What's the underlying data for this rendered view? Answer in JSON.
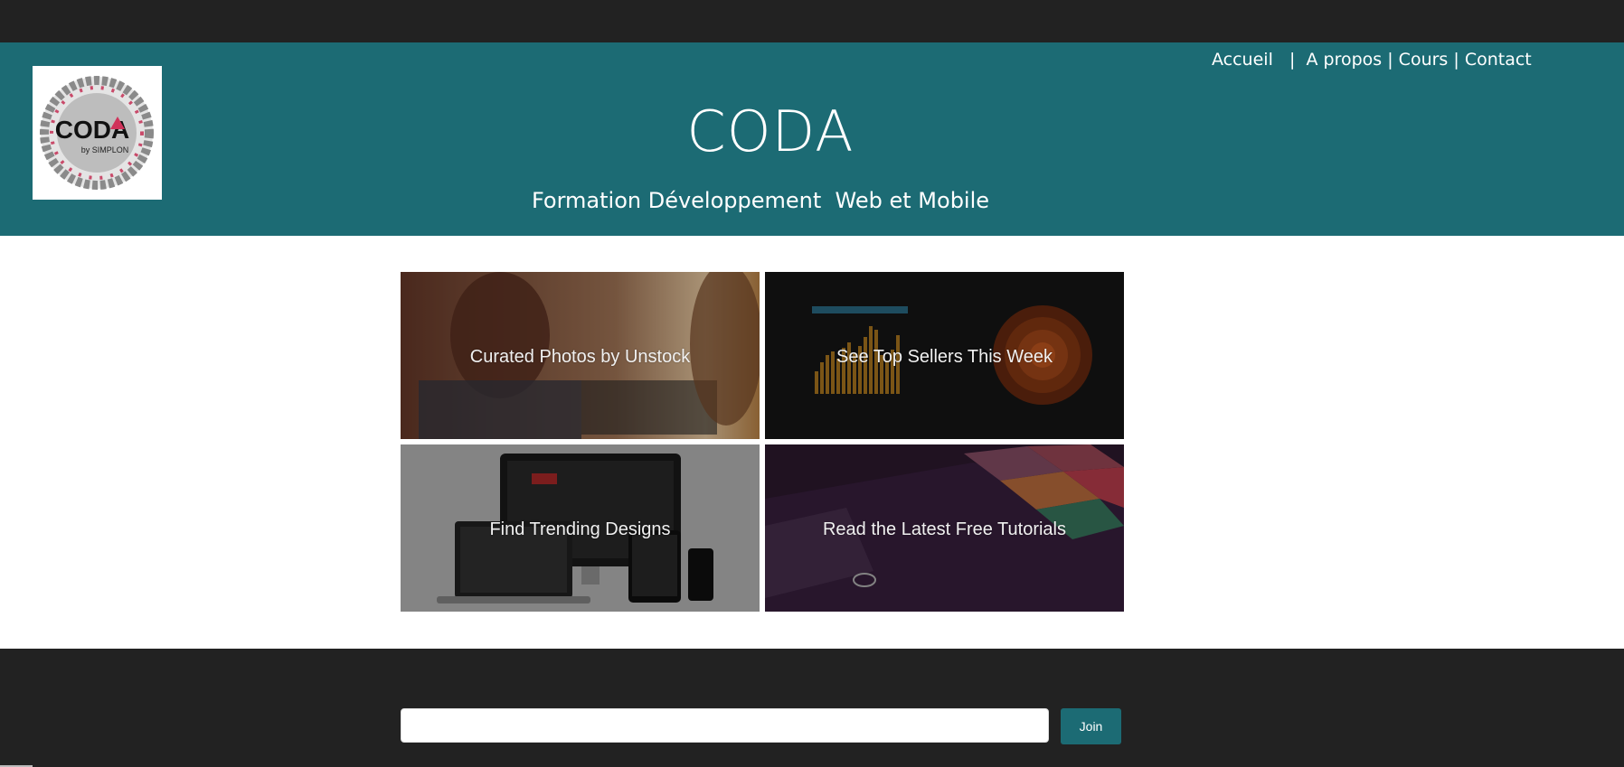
{
  "brand": {
    "title": "CODA",
    "tagline": "Formation Développement  Web et Mobile",
    "logo": {
      "word": "CODA",
      "sub": "by SIMPLON"
    }
  },
  "nav": {
    "items": [
      {
        "label": "Accueil"
      },
      {
        "label": "A propos"
      },
      {
        "label": "Cours"
      },
      {
        "label": "Contact"
      }
    ]
  },
  "tiles": [
    {
      "caption": "Curated Photos by Unstock"
    },
    {
      "caption": "See Top Sellers This Week"
    },
    {
      "caption": "Find Trending Designs"
    },
    {
      "caption": "Read the Latest Free Tutorials"
    }
  ],
  "newsletter": {
    "email_value": "",
    "join_label": "Join"
  },
  "colors": {
    "header": "#1c6b74",
    "topbar": "#222222",
    "accent_button": "#1c6b74"
  }
}
